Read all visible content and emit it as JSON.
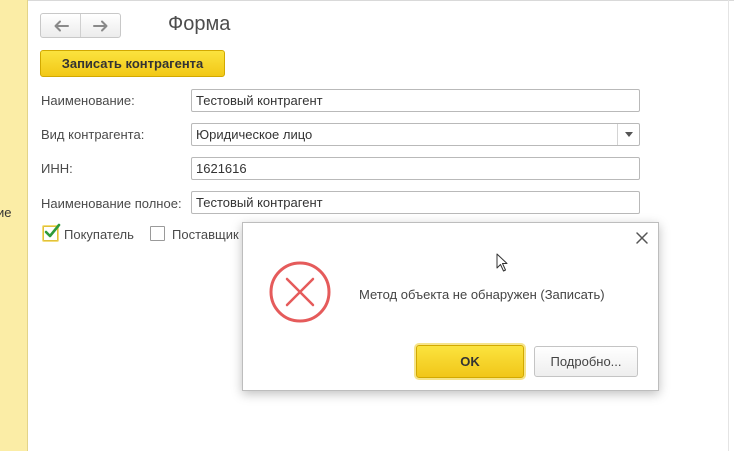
{
  "left_panel": {
    "cut_text": "ие"
  },
  "header": {
    "title": "Форма",
    "back_icon": "arrow-left-icon",
    "forward_icon": "arrow-right-icon"
  },
  "toolbar": {
    "save_label": "Записать контрагента"
  },
  "form": {
    "name_label": "Наименование:",
    "name_value": "Тестовый контрагент",
    "type_label": "Вид контрагента:",
    "type_value": "Юридическое лицо",
    "inn_label": "ИНН:",
    "inn_value": "1621616",
    "full_name_label": "Наименование полное:",
    "full_name_value": "Тестовый контрагент",
    "buyer_label": "Покупатель",
    "buyer_checked": true,
    "supplier_label": "Поставщик",
    "supplier_checked": false
  },
  "dialog": {
    "message": "Метод объекта не обнаружен (Записать)",
    "ok_label": "OK",
    "details_label": "Подробно...",
    "icon": "error-x-icon",
    "close_icon": "close-icon"
  },
  "colors": {
    "accent_yellow": "#f5d327",
    "panel_yellow": "#fbeda6",
    "error_red": "#e55b5b",
    "check_green": "#2e9a3a"
  }
}
